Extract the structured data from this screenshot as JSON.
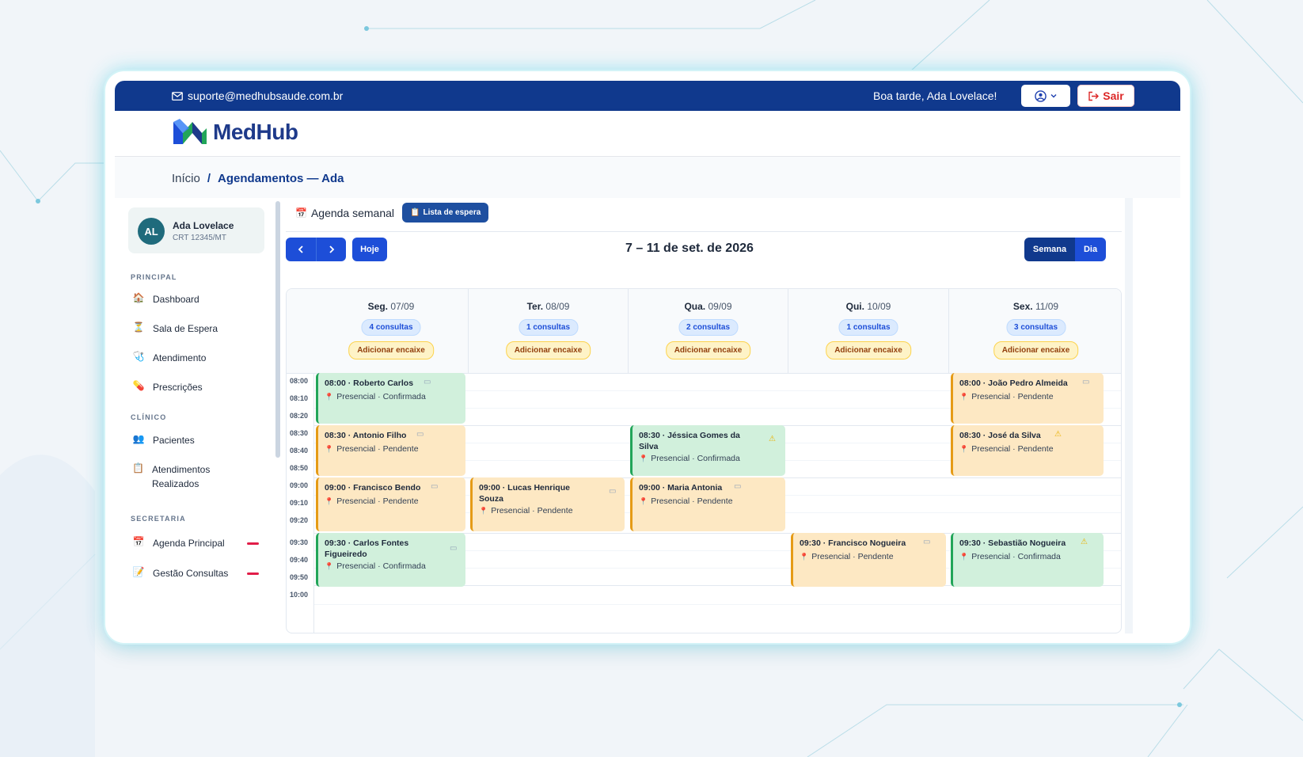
{
  "topbar": {
    "email": "suporte@medhubsaude.com.br",
    "greeting": "Boa tarde, Ada Lovelace!",
    "logout_label": "Sair"
  },
  "brand": {
    "name": "MedHub",
    "colors": {
      "blue": "#1d4ed8",
      "green": "#22a559",
      "navy": "#10398d"
    }
  },
  "breadcrumb": {
    "home": "Início",
    "separator": "/",
    "current": "Agendamentos — Ada"
  },
  "sidebar": {
    "user": {
      "initials": "AL",
      "name": "Ada Lovelace",
      "crt": "CRT 12345/MT"
    },
    "sections": [
      {
        "title": "PRINCIPAL",
        "items": [
          {
            "label": "Dashboard",
            "icon": "home-icon"
          },
          {
            "label": "Sala de Espera",
            "icon": "hourglass-icon"
          },
          {
            "label": "Atendimento",
            "icon": "stethoscope-icon"
          },
          {
            "label": "Prescrições",
            "icon": "pill-icon"
          }
        ]
      },
      {
        "title": "CLÍNICO",
        "items": [
          {
            "label": "Pacientes",
            "icon": "users-icon"
          },
          {
            "label": "Atendimentos Realizados",
            "icon": "notebook-icon"
          }
        ]
      },
      {
        "title": "SECRETARIA",
        "items": [
          {
            "label": "Agenda Principal",
            "icon": "calendar-icon"
          },
          {
            "label": "Gestão Consultas",
            "icon": "memo-icon"
          }
        ]
      }
    ]
  },
  "tabs": {
    "weekly": "Agenda semanal",
    "waitlist": "Lista de espera"
  },
  "toolbar": {
    "prev": "‹",
    "next": "›",
    "today": "Hoje",
    "range": "7 – 11 de set. de 2026",
    "week": "Semana",
    "day": "Dia"
  },
  "calendar": {
    "days": [
      {
        "name": "Seg.",
        "date": "07/09",
        "count": "4 consultas",
        "add": "Adicionar encaixe"
      },
      {
        "name": "Ter.",
        "date": "08/09",
        "count": "1 consultas",
        "add": "Adicionar encaixe"
      },
      {
        "name": "Qua.",
        "date": "09/09",
        "count": "2 consultas",
        "add": "Adicionar encaixe"
      },
      {
        "name": "Qui.",
        "date": "10/09",
        "count": "1 consultas",
        "add": "Adicionar encaixe"
      },
      {
        "name": "Sex.",
        "date": "11/09",
        "count": "3 consultas",
        "add": "Adicionar encaixe"
      }
    ],
    "times": [
      "08:00",
      "08:10",
      "08:20",
      "08:30",
      "08:40",
      "08:50",
      "09:00",
      "09:10",
      "09:20",
      "09:30",
      "09:40",
      "09:50",
      "10:00"
    ],
    "events": [
      {
        "title": "08:00 · Roberto Carlos",
        "sub": "Presencial · Confirmada",
        "status": "green",
        "flag": "monitor-icon"
      },
      {
        "title": "08:30 · Antonio Filho",
        "sub": "Presencial · Pendente",
        "status": "amber",
        "flag": "monitor-icon"
      },
      {
        "title": "09:00 · Francisco Bendo",
        "sub": "Presencial · Pendente",
        "status": "amber",
        "flag": "monitor-icon"
      },
      {
        "title": "09:30 · Carlos Fontes Figueiredo",
        "sub": "Presencial · Confirmada",
        "status": "green",
        "flag": "monitor-icon"
      },
      {
        "title": "09:00 · Lucas Henrique Souza",
        "sub": "Presencial · Pendente",
        "status": "amber",
        "flag": "monitor-icon"
      },
      {
        "title": "08:30 · Jéssica Gomes da Silva",
        "sub": "Presencial · Confirmada",
        "status": "green",
        "flag": "warning-icon"
      },
      {
        "title": "09:00 · Maria Antonia",
        "sub": "Presencial · Pendente",
        "status": "amber",
        "flag": "monitor-icon"
      },
      {
        "title": "09:30 · Francisco Nogueira",
        "sub": "Presencial · Pendente",
        "status": "amber",
        "flag": "monitor-icon"
      },
      {
        "title": "08:00 · João Pedro Almeida",
        "sub": "Presencial · Pendente",
        "status": "amber",
        "flag": "monitor-icon"
      },
      {
        "title": "08:30 · José da Silva",
        "sub": "Presencial · Pendente",
        "status": "amber",
        "flag": "warning-icon"
      },
      {
        "title": "09:30 · Sebastião Nogueira",
        "sub": "Presencial · Confirmada",
        "status": "green",
        "flag": "warning-icon"
      }
    ]
  }
}
